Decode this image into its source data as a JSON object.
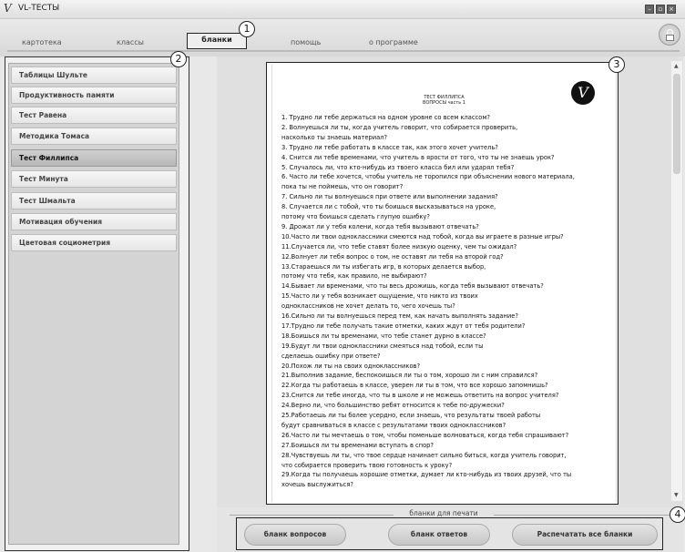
{
  "window": {
    "title": "VL-ТЕСТЫ",
    "icon": "vl-logo-icon",
    "controls": [
      "minimize-icon",
      "restore-icon",
      "close-icon"
    ]
  },
  "nav": {
    "tabs": [
      {
        "label": "картотека"
      },
      {
        "label": "классы"
      },
      {
        "label": "бланки",
        "active": true
      },
      {
        "label": "помощь"
      },
      {
        "label": "о программе"
      }
    ],
    "lock_icon": "padlock-icon"
  },
  "callouts": [
    "1",
    "2",
    "3",
    "4"
  ],
  "sidebar": {
    "items": [
      {
        "label": "Таблицы Шульте"
      },
      {
        "label": "Продуктивность памяти"
      },
      {
        "label": "Тест Равена"
      },
      {
        "label": "Методика Томаса"
      },
      {
        "label": "Тест Филлипса",
        "active": true
      },
      {
        "label": "Тест Минута"
      },
      {
        "label": "Тест Шмальта"
      },
      {
        "label": "Мотивация обучения"
      },
      {
        "label": "Цветовая социометрия"
      }
    ]
  },
  "document": {
    "title": "ТЕСТ ФИЛЛИПСА",
    "subtitle": "ВОПРОСЫ часть 1",
    "logo_letter": "V",
    "questions": [
      "1.  Трудно ли тебе держаться на одном уровне со всем классом?",
      "2.  Волнуешься ли ты, когда учитель говорит, что собирается проверить,",
      "насколько ты знаешь материал?",
      "3.  Трудно ли тебе работать в классе так, как этого хочет учитель?",
      "4.  Снится ли тебе временами, что учитель в ярости от того, что ты не знаешь урок?",
      "5.  Случалось ли, что кто-нибудь из твоего класса бил или ударял тебя?",
      "6.  Часто ли тебе хочется, чтобы учитель не торопился при объяснении нового материала,",
      "пока ты не поймешь, что он говорит?",
      "7.  Сильно ли ты волнуешься при ответе или выполнении задания?",
      "8.  Случается ли с тобой, что ты боишься высказываться на уроке,",
      "потому что боишься сделать глупую ошибку?",
      "9.  Дрожат ли у тебя колени, когда тебя вызывают отвечать?",
      "10.Часто ли твои одноклассники смеются над тобой, когда вы играете в разные игры?",
      "11.Случается ли, что тебе ставят более низкую оценку, чем ты ожидал?",
      "12.Волнует ли тебя вопрос о том, не оставят ли тебя на второй год?",
      "13.Стараешься ли ты избегать игр, в которых делается выбор,",
      "потому что тебя, как правило, не выбирают?",
      "14.Бывает ли временами, что ты весь дрожишь, когда тебя вызывают отвечать?",
      "15.Часто ли у тебя возникает ощущение, что никто из твоих",
      "одноклассников не хочет делать то, чего хочешь ты?",
      "16.Сильно ли ты волнуешься перед тем, как начать выполнять задание?",
      "17.Трудно ли тебе получать такие отметки, каких ждут от тебя родители?",
      "18.Боишься ли ты временами, что тебе станет дурно в классе?",
      "19.Будут ли твои одноклассники смеяться над тобой, если ты",
      "сделаешь ошибку при ответе?",
      "20.Похож ли ты на своих одноклассников?",
      "21.Выполнив задание, беспокоишься ли ты о том, хорошо ли с ним справился?",
      "22.Когда ты работаешь в классе, уверен ли ты в том, что все хорошо запомнишь?",
      "23.Снится ли тебе иногда, что ты в школе и не можешь ответить на вопрос учителя?",
      "24.Верно ли, что большинство ребят относится к тебе по-дружески?",
      "25.Работаешь ли ты более усердно, если знаешь, что результаты твоей работы",
      "будут сравниваться в классе с результатами твоих одноклассников?",
      "26.Часто ли ты мечтаешь о том, чтобы поменьше волноваться, когда тебя спрашивают?",
      "27.Боишься ли ты временами вступать в спор?",
      "28.Чувствуешь ли ты, что твое сердце начинает сильно биться, когда учитель говорит,",
      "что собирается проверить твою готовность к уроку?",
      "29.Когда ты получаешь хорошие отметки, думает ли кто-нибудь из твоих друзей, что ты",
      "хочешь выслужиться?"
    ]
  },
  "footer": {
    "group_label": "бланки для печати",
    "buttons": [
      {
        "label": "бланк вопросов"
      },
      {
        "label": "бланк ответов"
      },
      {
        "label": "Распечатать все бланки"
      }
    ]
  }
}
